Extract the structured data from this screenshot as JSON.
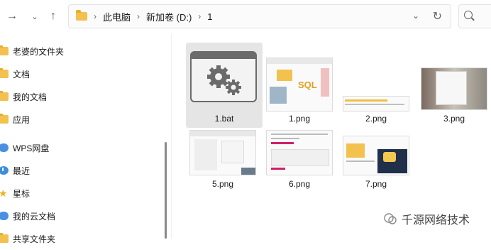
{
  "nav": {
    "back_icon": "arrow-left-icon",
    "forward_icon": "arrow-right-icon",
    "down_icon": "chevron-down-icon",
    "up_icon": "arrow-up-icon"
  },
  "breadcrumb": [
    "此电脑",
    "新加卷 (D:)",
    "1"
  ],
  "sidebar": {
    "items": [
      {
        "label": "老婆的文件夹",
        "icon": "folder-icon"
      },
      {
        "label": "文档",
        "icon": "folder-icon"
      },
      {
        "label": "我的文档",
        "icon": "folder-icon"
      },
      {
        "label": "应用",
        "icon": "folder-icon"
      },
      {
        "label": "WPS网盘",
        "icon": "cloud-icon"
      },
      {
        "label": "最近",
        "icon": "clock-icon"
      },
      {
        "label": "星标",
        "icon": "star-icon"
      },
      {
        "label": "我的云文档",
        "icon": "cloud-icon"
      },
      {
        "label": "共享文件夹",
        "icon": "folder-icon"
      }
    ]
  },
  "files": [
    {
      "name": "1.bat",
      "type": "bat",
      "selected": true
    },
    {
      "name": "1.png",
      "type": "png"
    },
    {
      "name": "2.png",
      "type": "png"
    },
    {
      "name": "3.png",
      "type": "png"
    },
    {
      "name": "5.png",
      "type": "png"
    },
    {
      "name": "6.png",
      "type": "png"
    },
    {
      "name": "7.png",
      "type": "png"
    }
  ],
  "watermark": {
    "text": "千源网络技术"
  },
  "colors": {
    "folder": "#f2c14e",
    "selected": "#e5e5e5",
    "accent": "#4a90e2"
  }
}
